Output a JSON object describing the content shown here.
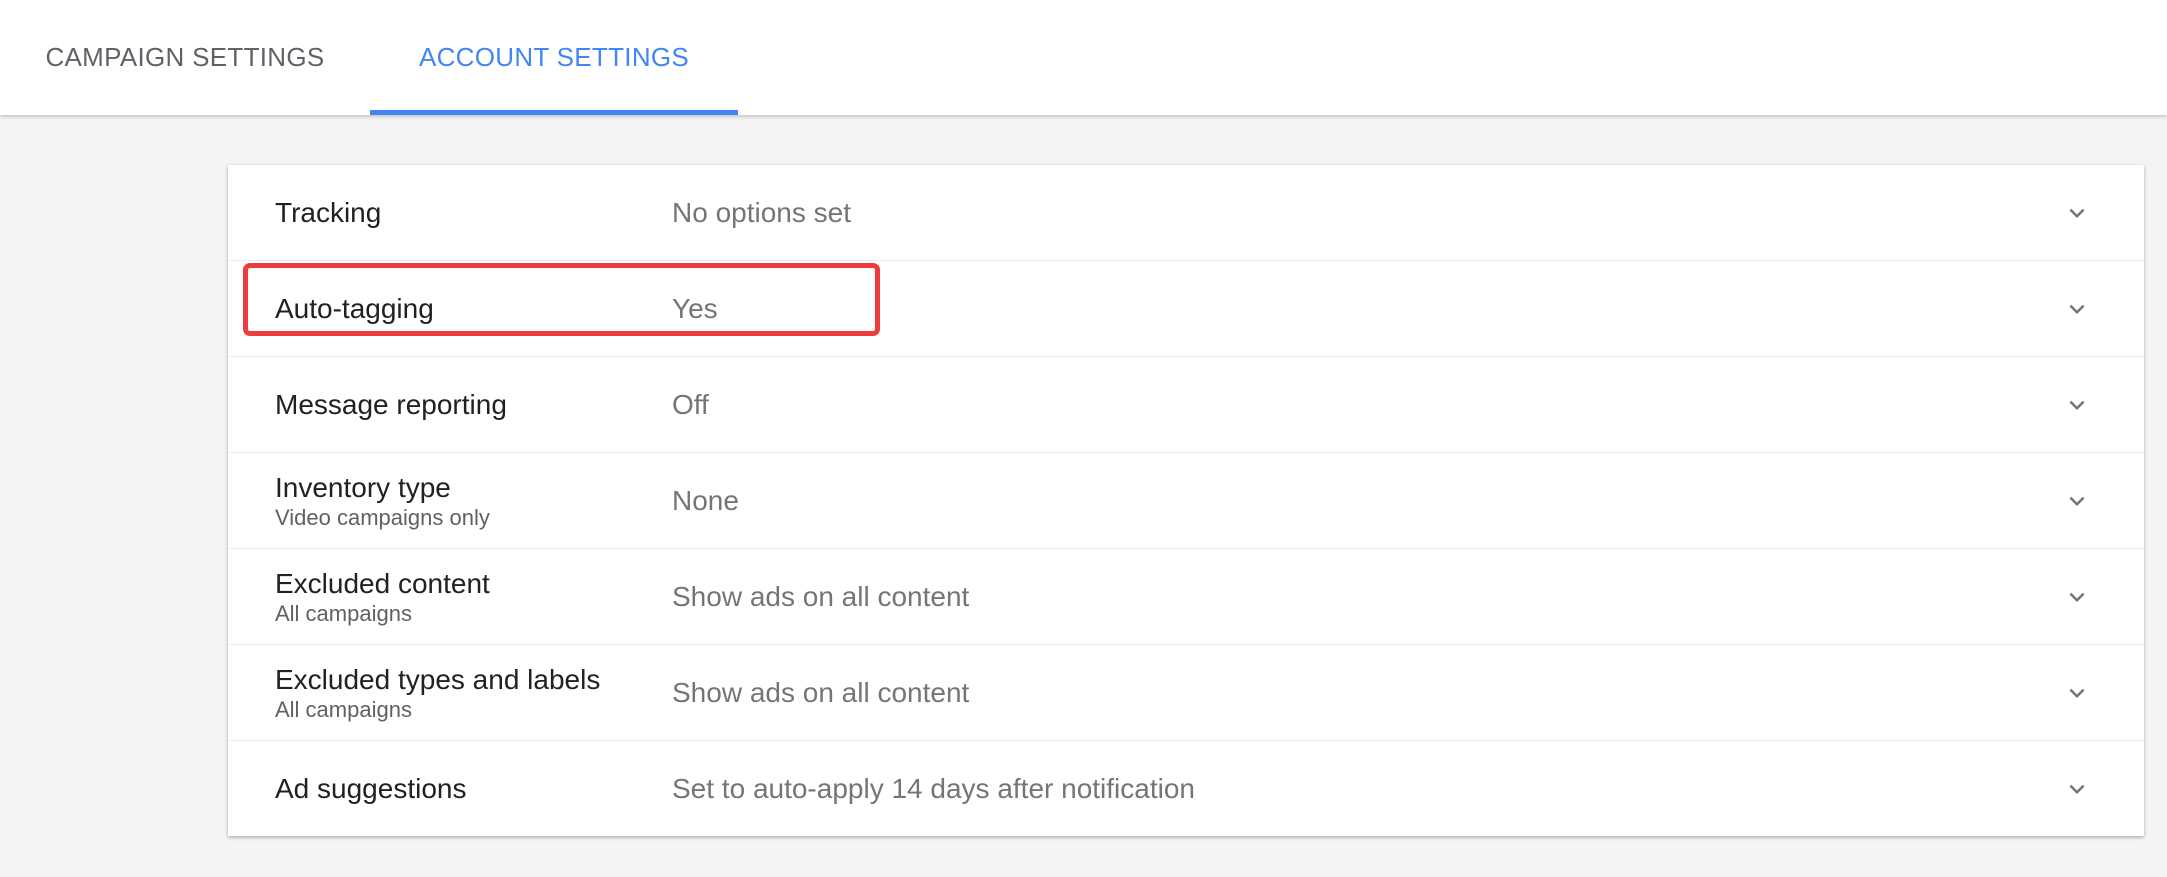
{
  "tabs": [
    {
      "label": "CAMPAIGN SETTINGS",
      "active": false
    },
    {
      "label": "ACCOUNT SETTINGS",
      "active": true
    }
  ],
  "colors": {
    "accent": "#4285f4",
    "highlight": "#ef3b3b"
  },
  "settings": [
    {
      "label": "Tracking",
      "sublabel": "",
      "value": "No options set",
      "icon": "chevron-down-icon"
    },
    {
      "label": "Auto-tagging",
      "sublabel": "",
      "value": "Yes",
      "icon": "chevron-down-icon",
      "highlighted": true
    },
    {
      "label": "Message reporting",
      "sublabel": "",
      "value": "Off",
      "icon": "chevron-down-icon"
    },
    {
      "label": "Inventory type",
      "sublabel": "Video campaigns only",
      "value": "None",
      "icon": "chevron-down-icon"
    },
    {
      "label": "Excluded content",
      "sublabel": "All campaigns",
      "value": "Show ads on all content",
      "icon": "chevron-down-icon"
    },
    {
      "label": "Excluded types and labels",
      "sublabel": "All campaigns",
      "value": "Show ads on all content",
      "icon": "chevron-down-icon"
    },
    {
      "label": "Ad suggestions",
      "sublabel": "",
      "value": "Set to auto-apply 14 days after notification",
      "icon": "chevron-down-icon"
    }
  ]
}
